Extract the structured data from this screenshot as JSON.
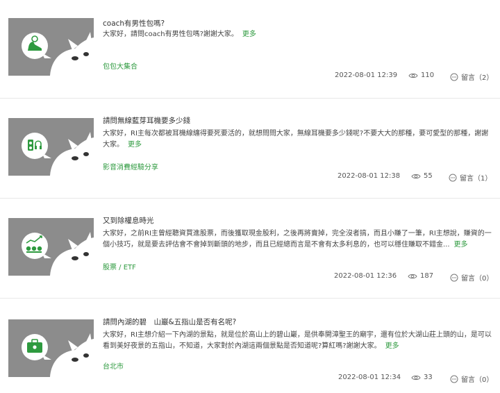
{
  "posts": [
    {
      "title": "coach有男性包嗎?",
      "excerpt": "大家好，請問coach有男性包嗎?謝謝大家。",
      "more": "更多",
      "category": "包包大集合",
      "date": "2022-08-01 12:39",
      "views": "110",
      "replies": "留言（2）",
      "icon": "shoe-icon"
    },
    {
      "title": "請問無線藍芽耳機要多少錢",
      "excerpt": "大家好，RI主每次都被耳機線纏得要死要活的，就想問問大家，無線耳機要多少錢呢?不要大大的那種，要可愛型的那種，謝謝大家。",
      "more": "更多",
      "category": "影音消費經驗分享",
      "date": "2022-08-01 12:38",
      "views": "55",
      "replies": "留言（1）",
      "icon": "speaker-headphone-icon"
    },
    {
      "title": "又到除權息時光",
      "excerpt": "大家好，之前RI主曾經聽資買進股票，而後獲取現金股利，之後再將賣掉，完全沒者搞，而且小賺了一筆，RI主想說，賺資的一個小技巧，就是要去評估會不會掉到斷頭的地步，而且已經總而言是不會有太多利息的，也可以穩住賺取不錯金...",
      "more": "更多",
      "category": "股票 / ETF",
      "date": "2022-08-01 12:36",
      "views": "187",
      "replies": "留言（0）",
      "icon": "stock-growth-icon"
    },
    {
      "title": "請問內湖的碧　山巖&五指山是否有名呢?",
      "excerpt": "大家好，RI主想介紹一下內湖的景點，就是位於高山上的碧山巖，是供奉開漳聖王的廟宇，還有位於大湖山莊上頭的山，是可以看到美好夜景的五指山，不知道，大家對於內湖這兩個景點是否知道呢?算紅嗎?謝謝大家。",
      "more": "更多",
      "category": "台北市",
      "date": "2022-08-01 12:34",
      "views": "33",
      "replies": "留言（0）",
      "icon": "briefcase-icon"
    }
  ],
  "colors": {
    "accent": "#2e9a3f",
    "thumb_bg": "#8c8c8c",
    "icon_green": "#2e9a3f"
  }
}
